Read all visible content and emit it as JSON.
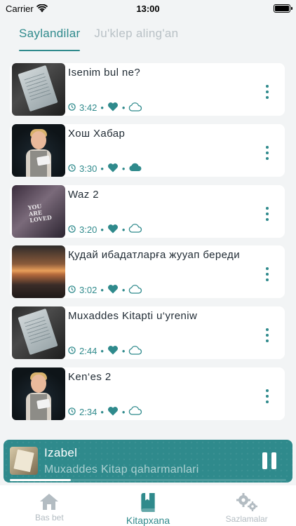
{
  "status_bar": {
    "carrier": "Carrier",
    "time": "13:00"
  },
  "tabs": [
    {
      "label": "Saylandilar",
      "active": true
    },
    {
      "label": "Ju'klep aling'an",
      "active": false
    }
  ],
  "items": [
    {
      "title": "Isenim bul ne?",
      "duration": "3:42",
      "favorite": true,
      "downloaded": false,
      "thumbnail": "paper"
    },
    {
      "title": "Хош Хабар",
      "duration": "3:30",
      "favorite": true,
      "downloaded": true,
      "thumbnail": "boy"
    },
    {
      "title": "Waz 2",
      "duration": "3:20",
      "favorite": true,
      "downloaded": false,
      "thumbnail": "loved",
      "thumbnail_text": "YOU ARE LOVED"
    },
    {
      "title": "Қудай ибадатларға жууап береди",
      "duration": "3:02",
      "favorite": true,
      "downloaded": false,
      "thumbnail": "sunset"
    },
    {
      "title": "Muxaddes Kitapti u‘yreniw",
      "duration": "2:44",
      "favorite": true,
      "downloaded": false,
      "thumbnail": "paper"
    },
    {
      "title": "Ken‘es 2",
      "duration": "2:34",
      "favorite": true,
      "downloaded": false,
      "thumbnail": "boy"
    }
  ],
  "player": {
    "title": "Izabel",
    "subtitle": "Muxaddes Kitap qaharmanlari",
    "progress": 0.22,
    "state": "playing"
  },
  "tabbar": [
    {
      "label": "Bas bet",
      "icon": "home-icon",
      "active": false
    },
    {
      "label": "Kitapxana",
      "icon": "book-icon",
      "active": true
    },
    {
      "label": "Sazlamalar",
      "icon": "gears-icon",
      "active": false
    }
  ],
  "colors": {
    "accent": "#2f8a8c",
    "background": "#f2f4f5",
    "inactive": "#b9c1c6"
  }
}
